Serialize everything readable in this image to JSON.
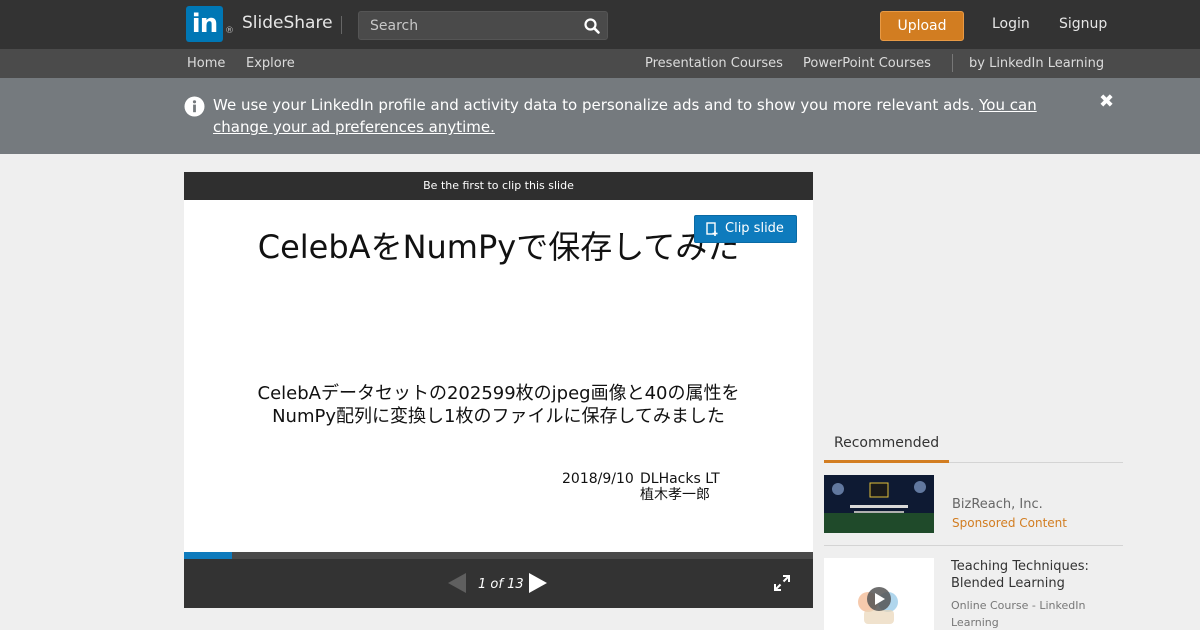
{
  "header": {
    "logo_letters": "in",
    "logo_mark": "®",
    "brand": "SlideShare",
    "search_placeholder": "Search",
    "upload_label": "Upload",
    "login_label": "Login",
    "signup_label": "Signup"
  },
  "subnav": {
    "home": "Home",
    "explore": "Explore",
    "presentation_courses": "Presentation Courses",
    "powerpoint_courses": "PowerPoint Courses",
    "linkedin_learning": "by LinkedIn Learning"
  },
  "notice": {
    "text": "We use your LinkedIn profile and activity data to personalize ads and to show you more relevant ads. ",
    "link": "You can change your ad preferences anytime.",
    "close_glyph": "✖"
  },
  "player": {
    "clip_prompt": "Be the first to clip this slide",
    "clip_button": "Clip slide",
    "slide_title": "CelebAをNumPyで保存してみた",
    "slide_body_line1": "CelebAデータセットの202599枚のjpeg画像と40の属性を",
    "slide_body_line2": "NumPy配列に変換し1枚のファイルに保存してみました",
    "slide_date": "2018/9/10",
    "slide_event": "DLHacks LT",
    "slide_author": "植木孝一郎",
    "page_count": "1 of 13",
    "current_page": 1,
    "total_pages": 13
  },
  "recommended": {
    "tab_label": "Recommended",
    "items": [
      {
        "title": "BizReach, Inc.",
        "subtitle": "Sponsored Content"
      },
      {
        "title": "Teaching Techniques: Blended Learning",
        "subtitle": "Online Course - LinkedIn Learning"
      }
    ]
  },
  "colors": {
    "header_bg": "#333333",
    "subnav_bg": "#4b4b4b",
    "notice_bg": "#757a7e",
    "accent_orange": "#d27d21",
    "accent_blue": "#0e7bbd"
  }
}
